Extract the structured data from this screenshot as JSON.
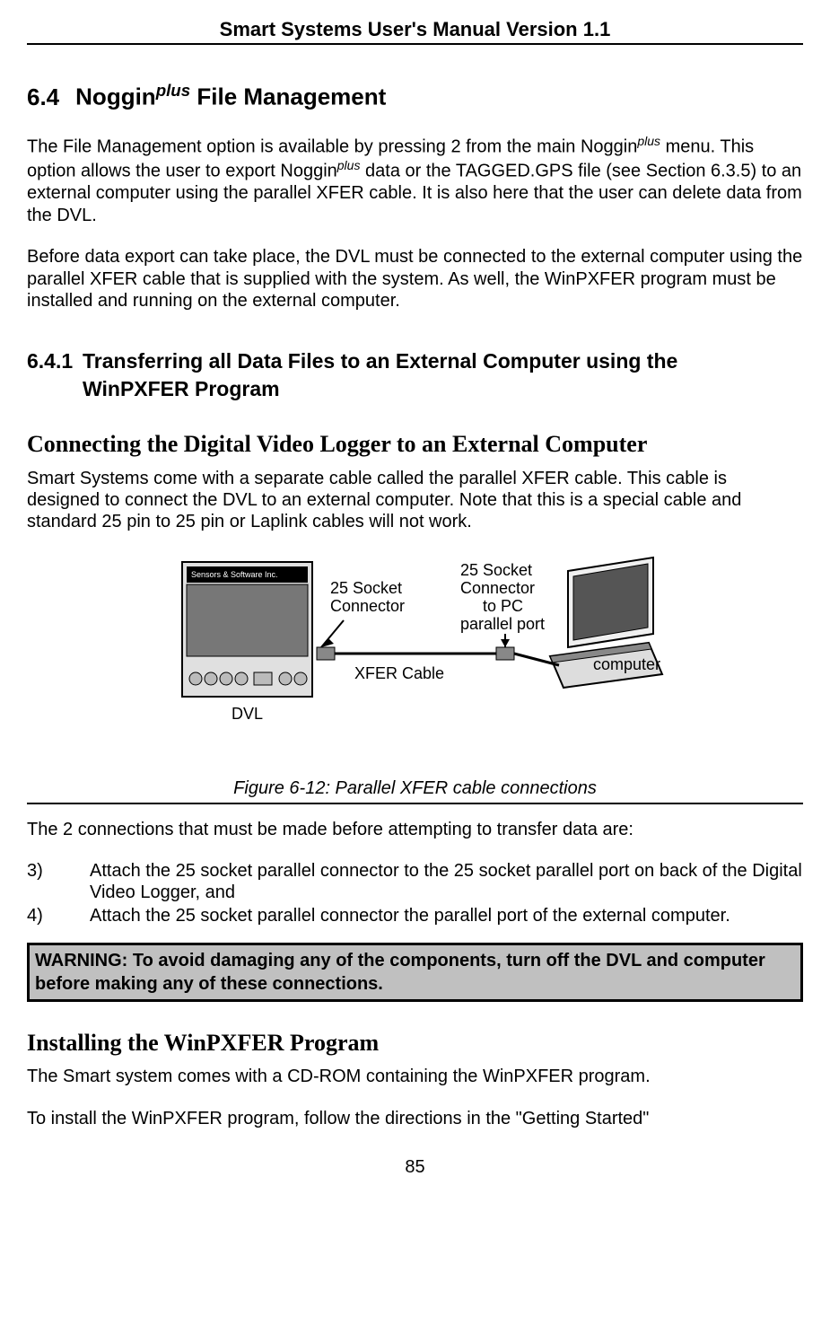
{
  "header": "Smart Systems User's Manual Version 1.1",
  "section": {
    "number": "6.4",
    "brand": "Noggin",
    "super": "plus",
    "rest": " File Management"
  },
  "para1_a": "The File Management option is available by pressing 2 from the main Noggin",
  "para1_sup": "plus",
  "para1_b": " menu. This option allows the user to export Noggin",
  "para1_c": " data or the TAGGED.GPS file (see Section 6.3.5) to an external computer using the parallel XFER cable.  It is also here that the user can delete data from the DVL.",
  "para2": "Before data export can take place, the DVL must be connected to the external computer using the parallel XFER cable that is supplied with the system.  As well, the WinPXFER program must be installed and running on the external computer.",
  "subsection": {
    "number": "6.4.1",
    "title": "Transferring all Data Files to an External Computer using the WinPXFER Program"
  },
  "serif1": "Connecting the Digital Video Logger to an External Computer",
  "para3": "Smart Systems come with a separate cable called the parallel XFER cable. This cable is designed to connect the DVL to an external computer. Note that this is a special cable and standard 25 pin to 25 pin or Laplink cables will not work.",
  "figure": {
    "dvl_brand": "Sensors & Software Inc.",
    "dvl_label": "DVL",
    "left_conn_l1": "25 Socket",
    "left_conn_l2": "Connector",
    "cable_label": "XFER Cable",
    "right_conn_l1": "25 Socket",
    "right_conn_l2": "Connector",
    "right_conn_l3": "to PC",
    "right_conn_l4": "parallel port",
    "computer_label": "computer",
    "caption": "Figure 6-12: Parallel XFER cable connections"
  },
  "para4": "The 2 connections that must be made before attempting to transfer data are:",
  "list": [
    {
      "n": "3)",
      "t": "Attach the 25 socket parallel connector to the 25 socket parallel port on back of the Digital Video Logger, and"
    },
    {
      "n": "4)",
      "t": "Attach the 25 socket parallel connector the parallel port of the external computer."
    }
  ],
  "warning": "WARNING: To avoid damaging any of the components, turn off the DVL and computer before making any of these connections.",
  "serif2": "Installing the WinPXFER Program",
  "para5": "The Smart system comes with a CD-ROM containing the WinPXFER program.",
  "para6": "To install the WinPXFER program, follow the directions in the \"Getting Started\"",
  "page_number": "85"
}
